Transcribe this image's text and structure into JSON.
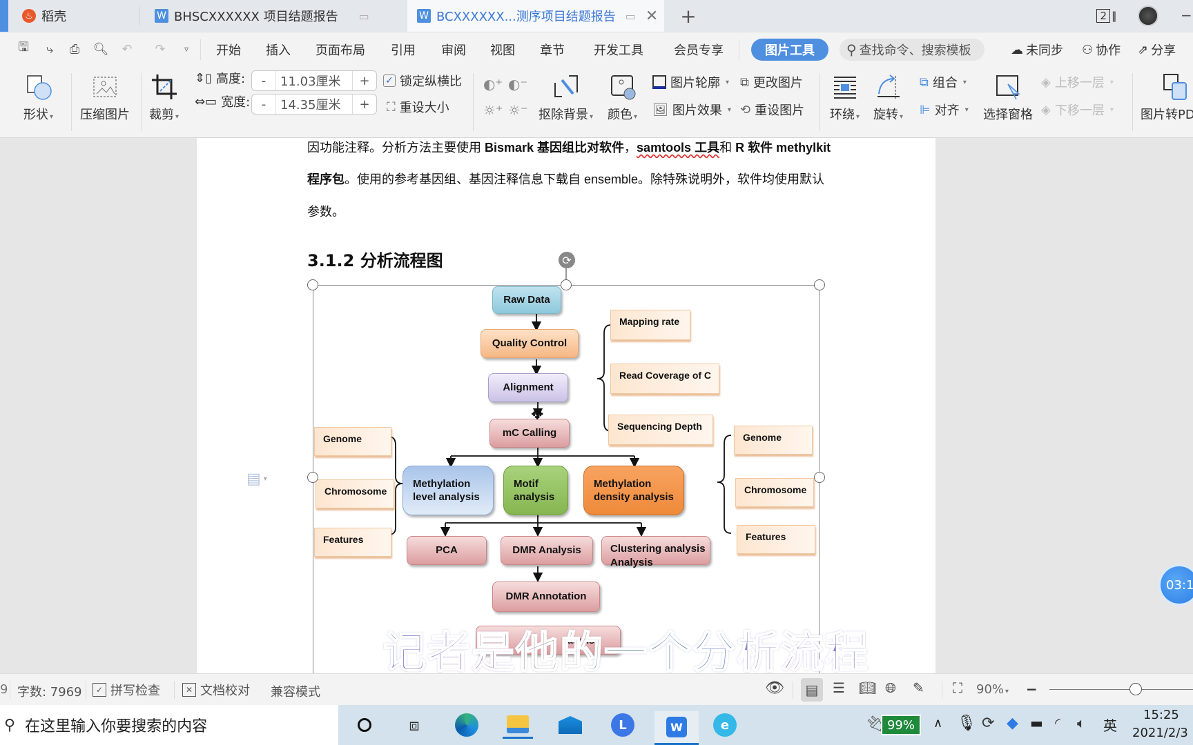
{
  "tabs": [
    {
      "label": "稻壳",
      "icon": "daoke-logo-icon",
      "active": false
    },
    {
      "label": "BHSCXXXXXX 项目结题报告",
      "icon": "wps-writer-icon",
      "active": false
    },
    {
      "label": "BCXXXXXX...测序项目结题报告",
      "icon": "wps-writer-icon",
      "active": true
    }
  ],
  "window": {
    "window_count": "2"
  },
  "menu": {
    "items": [
      "开始",
      "插入",
      "页面布局",
      "引用",
      "审阅",
      "视图",
      "章节",
      "开发工具",
      "会员专享"
    ],
    "active_tool": "图片工具",
    "search_placeholder": "查找命令、搜索模板",
    "sync": "未同步",
    "collab": "协作",
    "share": "分享"
  },
  "ribbon": {
    "shape": "形状",
    "compress": "压缩图片",
    "crop": "裁剪",
    "height_label": "高度:",
    "height_value": "11.03厘米",
    "width_label": "宽度:",
    "width_value": "14.35厘米",
    "minus": "-",
    "plus": "+",
    "lock_ratio": "锁定纵横比",
    "lock_ratio_checked": true,
    "reset_size": "重设大小",
    "remove_bg": "抠除背景",
    "color": "颜色",
    "outline": "图片轮廓",
    "effects": "图片效果",
    "change_pic": "更改图片",
    "reset_pic": "重设图片",
    "wrap": "环绕",
    "rotate": "旋转",
    "group": "组合",
    "align": "对齐",
    "selection_pane": "选择窗格",
    "bring_forward": "上移一层",
    "send_backward": "下移一层",
    "pic_to_pdf": "图片转PDF"
  },
  "document": {
    "line1_parts": [
      {
        "text": "因功能注释。分析方法主要使用 ",
        "bold": false
      },
      {
        "text": "Bismark 基因组比对软件",
        "bold": true
      },
      {
        "text": "，",
        "bold": false
      },
      {
        "text": "samtools 工具",
        "bold": true
      },
      {
        "text": "和  ",
        "bold": false
      },
      {
        "text": "R 软件 methylkit",
        "bold": true
      }
    ],
    "line2_parts": [
      {
        "text": "程序包",
        "bold": true
      },
      {
        "text": "。使用的参考基因组、基因注释信息下载自 ensemble。除特殊说明外，软件均使用默认",
        "bold": false
      }
    ],
    "line3": "参数。",
    "heading": "3.1.2  分析流程图"
  },
  "flowchart": {
    "raw_data": "Raw Data",
    "quality_control": "Quality Control",
    "alignment": "Alignment",
    "mc_calling": "mC Calling",
    "qc_metrics": [
      "Mapping rate",
      "Read Coverage of C",
      "Sequencing Depth"
    ],
    "methylation_level": "Methylation level analysis",
    "motif": "Motif analysis",
    "methylation_density": "Methylation density analysis",
    "left_features": [
      "Genome",
      "Chromosome",
      "Features"
    ],
    "right_features": [
      "Genome",
      "Chromosome",
      "Features"
    ],
    "pca": "PCA",
    "dmr_analysis": "DMR Analysis",
    "clustering": "Clustering analysis Analysis",
    "dmr_annotation": "DMR Annotation",
    "partial_box": "alysis"
  },
  "subtitle": "记者是他的一个分析流程",
  "timer": "03:1",
  "status": {
    "page_fragment": "9",
    "word_count": "字数: 7969",
    "spell_check": "拼写检查",
    "doc_proof": "文档校对",
    "compat_mode": "兼容模式",
    "zoom": "90%",
    "zoom_fraction": 0.6
  },
  "taskbar": {
    "search_placeholder": "在这里输入你要搜索的内容",
    "battery": "99%",
    "ime": "英",
    "time": "15:25",
    "date": "2021/2/3"
  },
  "colors": {
    "accent": "#4e8fe0",
    "active_tab_text": "#3b78d6",
    "battery_green": "#1f8a3b"
  }
}
